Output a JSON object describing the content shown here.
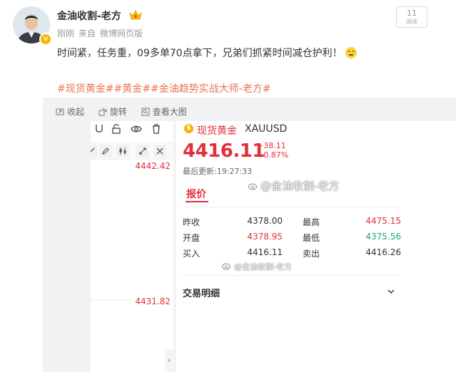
{
  "post": {
    "username": "金油收割-老方",
    "meta": {
      "time": "刚刚",
      "source_prefix": "来自",
      "source": "微博网页版"
    },
    "read_count": "11",
    "read_label": "阅读",
    "content": "时间紧，任务重，09多单70点拿下，兄弟们抓紧时间减仓护利！",
    "hashtags": "#现货黄金##黄金##金油趋势实战大师-老方#"
  },
  "image_tools": [
    {
      "label": "收起",
      "icon": "collapse-icon"
    },
    {
      "label": "旋转",
      "icon": "rotate-icon"
    },
    {
      "label": "查看大图",
      "icon": "view-large-icon"
    }
  ],
  "chart_panel": {
    "price_top": "4442.42",
    "price_bottom": "4431.82"
  },
  "quote": {
    "name": "现货黄金",
    "code": "XAUUSD",
    "price": "4416.11",
    "change": "+38.11",
    "change_pct": "+0.87%",
    "updated": "最后更新:19:27:33",
    "tab": "报价",
    "watermark": "@金油收割-老方",
    "rows": [
      {
        "l1": "昨收",
        "v1": "4378.00",
        "l2": "最高",
        "v2": "4475.15"
      },
      {
        "l1": "开盘",
        "v1": "4378.95",
        "l2": "最低",
        "v2": "4375.56"
      },
      {
        "l1": "买入",
        "v1": "4416.11",
        "l2": "卖出",
        "v2": "4416.26"
      }
    ],
    "detail": "交易明细"
  },
  "colors": {
    "up": "#e0303b",
    "down": "#1aa57a",
    "hashtag": "#eb7350",
    "gold": "#f7b500"
  }
}
